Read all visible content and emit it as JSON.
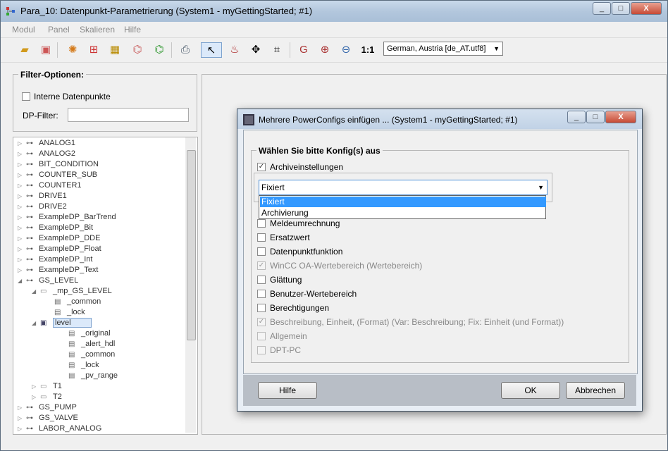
{
  "window": {
    "title": "Para_10: Datenpunkt-Parametrierung (System1 - myGettingStarted; #1)",
    "controls": {
      "minimize": "_",
      "maximize": "□",
      "close": "X"
    }
  },
  "menu": [
    "Modul",
    "Panel",
    "Skalieren",
    "Hilfe"
  ],
  "toolbar": {
    "zoom_label": "1:1",
    "language": "German, Austria [de_AT.utf8]"
  },
  "filter": {
    "legend": "Filter-Optionen:",
    "internal_label": "Interne Datenpunkte",
    "dp_filter_label": "DP-Filter:",
    "dp_filter_value": ""
  },
  "tree": [
    {
      "label": "ANALOG1",
      "level": 0,
      "exp": "▷",
      "icon": "dp"
    },
    {
      "label": "ANALOG2",
      "level": 0,
      "exp": "▷",
      "icon": "dp"
    },
    {
      "label": "BIT_CONDITION",
      "level": 0,
      "exp": "▷",
      "icon": "dp"
    },
    {
      "label": "COUNTER_SUB",
      "level": 0,
      "exp": "▷",
      "icon": "dp"
    },
    {
      "label": "COUNTER1",
      "level": 0,
      "exp": "▷",
      "icon": "dp"
    },
    {
      "label": "DRIVE1",
      "level": 0,
      "exp": "▷",
      "icon": "dp"
    },
    {
      "label": "DRIVE2",
      "level": 0,
      "exp": "▷",
      "icon": "dp"
    },
    {
      "label": "ExampleDP_BarTrend",
      "level": 0,
      "exp": "▷",
      "icon": "dp"
    },
    {
      "label": "ExampleDP_Bit",
      "level": 0,
      "exp": "▷",
      "icon": "dp"
    },
    {
      "label": "ExampleDP_DDE",
      "level": 0,
      "exp": "▷",
      "icon": "dp"
    },
    {
      "label": "ExampleDP_Float",
      "level": 0,
      "exp": "▷",
      "icon": "dp"
    },
    {
      "label": "ExampleDP_Int",
      "level": 0,
      "exp": "▷",
      "icon": "dp"
    },
    {
      "label": "ExampleDP_Text",
      "level": 0,
      "exp": "▷",
      "icon": "dp"
    },
    {
      "label": "GS_LEVEL",
      "level": 0,
      "exp": "◢",
      "icon": "dp"
    },
    {
      "label": "_mp_GS_LEVEL",
      "level": 1,
      "exp": "◢",
      "icon": "mp"
    },
    {
      "label": "_common",
      "level": 2,
      "exp": "",
      "icon": "cfg"
    },
    {
      "label": "_lock",
      "level": 2,
      "exp": "",
      "icon": "cfg"
    },
    {
      "label": "level",
      "level": 1,
      "exp": "◢",
      "icon": "elem",
      "selected": true
    },
    {
      "label": "_original",
      "level": 3,
      "exp": "",
      "icon": "cfg"
    },
    {
      "label": "_alert_hdl",
      "level": 3,
      "exp": "",
      "icon": "cfg"
    },
    {
      "label": "_common",
      "level": 3,
      "exp": "",
      "icon": "cfg"
    },
    {
      "label": "_lock",
      "level": 3,
      "exp": "",
      "icon": "cfg"
    },
    {
      "label": "_pv_range",
      "level": 3,
      "exp": "",
      "icon": "cfg"
    },
    {
      "label": "T1",
      "level": 1,
      "exp": "▷",
      "icon": "folder"
    },
    {
      "label": "T2",
      "level": 1,
      "exp": "▷",
      "icon": "folder"
    },
    {
      "label": "GS_PUMP",
      "level": 0,
      "exp": "▷",
      "icon": "dp"
    },
    {
      "label": "GS_VALVE",
      "level": 0,
      "exp": "▷",
      "icon": "dp"
    },
    {
      "label": "LABOR_ANALOG",
      "level": 0,
      "exp": "▷",
      "icon": "dp"
    }
  ],
  "dialog": {
    "title": "Mehrere PowerConfigs einfügen ... (System1 - myGettingStarted; #1)",
    "group_legend": "Wählen Sie bitte Konfig(s) aus",
    "combo_value": "Fixiert",
    "dropdown_options": [
      "Fixiert",
      "Archivierung"
    ],
    "options": [
      {
        "label": "Archiveinstellungen",
        "checked": true,
        "disabled": false
      },
      {
        "label": "Meldeumrechnung",
        "checked": false,
        "disabled": false
      },
      {
        "label": "Ersatzwert",
        "checked": false,
        "disabled": false
      },
      {
        "label": "Datenpunktfunktion",
        "checked": false,
        "disabled": false
      },
      {
        "label": "WinCC OA-Wertebereich (Wertebereich)",
        "checked": true,
        "disabled": true
      },
      {
        "label": "Glättung",
        "checked": false,
        "disabled": false
      },
      {
        "label": "Benutzer-Wertebereich",
        "checked": false,
        "disabled": false
      },
      {
        "label": "Berechtigungen",
        "checked": false,
        "disabled": false
      },
      {
        "label": "Beschreibung, Einheit, (Format) (Var: Beschreibung; Fix: Einheit (und Format))",
        "checked": true,
        "disabled": true
      },
      {
        "label": "Allgemein",
        "checked": false,
        "disabled": true
      },
      {
        "label": "DPT-PC",
        "checked": false,
        "disabled": true
      }
    ],
    "buttons": {
      "help": "Hilfe",
      "ok": "OK",
      "cancel": "Abbrechen"
    }
  },
  "colors": {
    "selection": "#3399ff",
    "titlebar": "#b9cce2"
  }
}
